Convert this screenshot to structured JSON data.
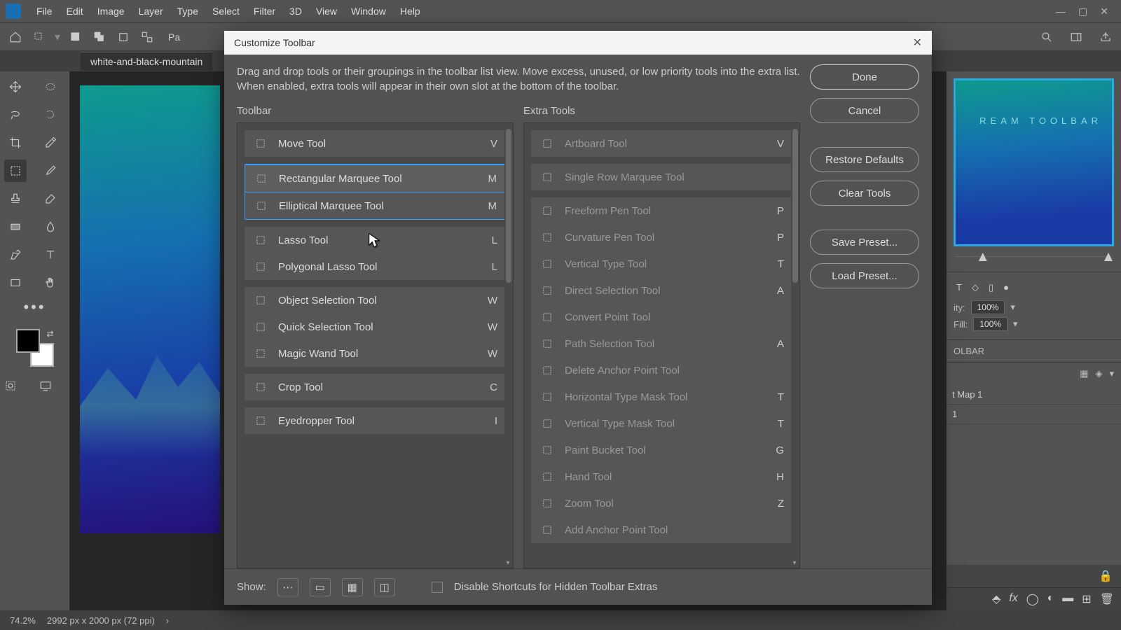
{
  "menu": [
    "File",
    "Edit",
    "Image",
    "Layer",
    "Type",
    "Select",
    "Filter",
    "3D",
    "View",
    "Window",
    "Help"
  ],
  "doc_tab": "white-and-black-mountain",
  "status": {
    "zoom": "74.2%",
    "info": "2992 px x 2000 px (72 ppi)"
  },
  "preview_label": "REAM TOOLBAR",
  "right": {
    "opacity_label": "ity:",
    "opacity": "100%",
    "fill_label": "Fill:",
    "fill": "100%",
    "section": "OLBAR",
    "layers": [
      "t Map 1",
      "1"
    ]
  },
  "dialog": {
    "title": "Customize Toolbar",
    "desc": "Drag and drop tools or their groupings in the toolbar list view. Move excess, unused, or low priority tools into the extra list. When enabled, extra tools will appear in their own slot at the bottom of the toolbar.",
    "col1": "Toolbar",
    "col2": "Extra Tools",
    "show_label": "Show:",
    "checkbox": "Disable Shortcuts for Hidden Toolbar Extras",
    "buttons": {
      "done": "Done",
      "cancel": "Cancel",
      "restore": "Restore Defaults",
      "clear": "Clear Tools",
      "save": "Save Preset...",
      "load": "Load Preset..."
    },
    "toolbar_groups": [
      {
        "items": [
          {
            "name": "Move Tool",
            "key": "V"
          }
        ]
      },
      {
        "selected": true,
        "items": [
          {
            "name": "Rectangular Marquee Tool",
            "key": "M",
            "sel": true
          },
          {
            "name": "Elliptical Marquee Tool",
            "key": "M"
          }
        ]
      },
      {
        "items": [
          {
            "name": "Lasso Tool",
            "key": "L"
          },
          {
            "name": "Polygonal Lasso Tool",
            "key": "L"
          }
        ]
      },
      {
        "items": [
          {
            "name": "Object Selection Tool",
            "key": "W"
          },
          {
            "name": "Quick Selection Tool",
            "key": "W"
          },
          {
            "name": "Magic Wand Tool",
            "key": "W"
          }
        ]
      },
      {
        "items": [
          {
            "name": "Crop Tool",
            "key": "C"
          }
        ]
      },
      {
        "items": [
          {
            "name": "Eyedropper Tool",
            "key": "I"
          }
        ]
      }
    ],
    "extra_groups": [
      {
        "items": [
          {
            "name": "Artboard Tool",
            "key": "V"
          }
        ]
      },
      {
        "items": [
          {
            "name": "Single Row Marquee Tool",
            "key": ""
          }
        ]
      },
      {
        "items": [
          {
            "name": "Freeform Pen Tool",
            "key": "P"
          },
          {
            "name": "Curvature Pen Tool",
            "key": "P"
          },
          {
            "name": "Vertical Type Tool",
            "key": "T"
          },
          {
            "name": "Direct Selection Tool",
            "key": "A"
          },
          {
            "name": "Convert Point Tool",
            "key": ""
          },
          {
            "name": "Path Selection Tool",
            "key": "A"
          },
          {
            "name": "Delete Anchor Point Tool",
            "key": ""
          },
          {
            "name": "Horizontal Type Mask Tool",
            "key": "T"
          },
          {
            "name": "Vertical Type Mask Tool",
            "key": "T"
          },
          {
            "name": "Paint Bucket Tool",
            "key": "G"
          },
          {
            "name": "Hand Tool",
            "key": "H"
          },
          {
            "name": "Zoom Tool",
            "key": "Z"
          },
          {
            "name": "Add Anchor Point Tool",
            "key": ""
          }
        ]
      }
    ]
  }
}
